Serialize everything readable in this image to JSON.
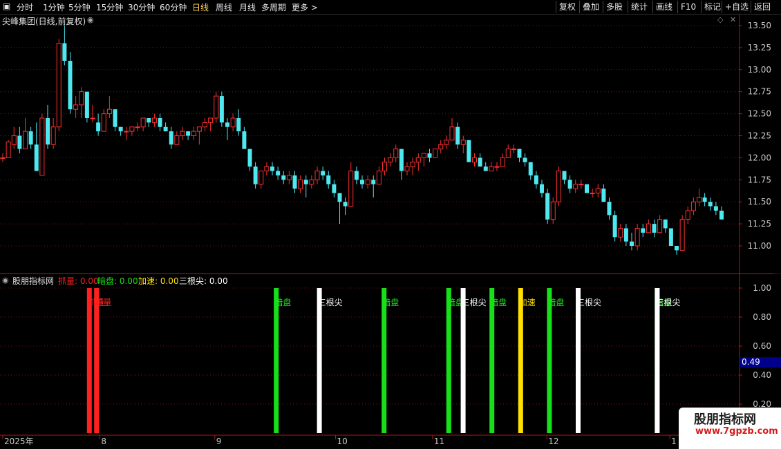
{
  "toolbar": {
    "periods": [
      "分时",
      "1分钟",
      "5分钟",
      "15分钟",
      "30分钟",
      "60分钟",
      "日线",
      "周线",
      "月线",
      "多周期",
      "更多 >"
    ],
    "active_period": "日线",
    "buttons": [
      "复权",
      "叠加",
      "多股",
      "统计",
      "画线",
      "F10",
      "标记",
      "+自选",
      "返回"
    ]
  },
  "main_panel": {
    "title": "尖峰集团(日线,前复权)",
    "price_axis": [
      "13.50",
      "13.25",
      "13.00",
      "12.75",
      "12.50",
      "12.25",
      "12.00",
      "11.75",
      "11.50",
      "11.25",
      "11.00"
    ]
  },
  "indicator_panel": {
    "title": "股朋指标网",
    "fields": [
      {
        "label": "抓量:",
        "value": "0.00",
        "color": "#ff2020"
      },
      {
        "label": "暗盘:",
        "value": "0.00",
        "color": "#18e018"
      },
      {
        "label": "加速:",
        "value": "0.00",
        "color": "#ffe000"
      },
      {
        "label": "三根尖:",
        "value": "0.00",
        "color": "#ffffff"
      }
    ],
    "y_axis": [
      "1.00",
      "0.80",
      "0.60",
      "0.40",
      "0.20"
    ],
    "cursor_value": "0.49"
  },
  "date_axis": [
    "2025年",
    "8",
    "9",
    "10",
    "11",
    "12",
    "1"
  ],
  "watermark": {
    "title": "股朋指标网",
    "url": "www.7gpzb.com"
  },
  "colors": {
    "up": "#ff3030",
    "down": "#4de8f0",
    "grid": "#7a1010",
    "axis": "#b01818"
  },
  "chart_data": {
    "type": "candlestick",
    "yrange_price": [
      10.85,
      13.62
    ],
    "ohlc_estimated": [
      [
        12.0,
        12.05,
        11.95,
        12.0
      ],
      [
        12.0,
        12.2,
        12.0,
        12.18
      ],
      [
        12.15,
        12.35,
        12.1,
        12.25
      ],
      [
        12.25,
        12.35,
        12.05,
        12.1
      ],
      [
        12.1,
        12.45,
        12.1,
        12.3
      ],
      [
        12.3,
        12.35,
        12.1,
        12.15
      ],
      [
        12.15,
        12.4,
        11.85,
        11.85
      ],
      [
        11.8,
        12.5,
        11.8,
        12.45
      ],
      [
        12.45,
        12.6,
        12.1,
        12.15
      ],
      [
        12.15,
        12.45,
        12.1,
        12.35
      ],
      [
        12.35,
        13.35,
        12.3,
        13.3
      ],
      [
        13.3,
        13.5,
        13.05,
        13.1
      ],
      [
        13.1,
        13.2,
        12.5,
        12.55
      ],
      [
        12.55,
        12.7,
        12.45,
        12.6
      ],
      [
        12.6,
        12.8,
        12.45,
        12.75
      ],
      [
        12.75,
        12.75,
        12.4,
        12.45
      ],
      [
        12.45,
        12.6,
        12.4,
        12.45
      ],
      [
        12.4,
        12.5,
        12.25,
        12.3
      ],
      [
        12.3,
        12.55,
        12.3,
        12.5
      ],
      [
        12.5,
        12.7,
        12.45,
        12.55
      ],
      [
        12.55,
        12.55,
        12.3,
        12.35
      ],
      [
        12.35,
        12.35,
        12.25,
        12.3
      ],
      [
        12.3,
        12.35,
        12.2,
        12.3
      ],
      [
        12.3,
        12.35,
        12.25,
        12.35
      ],
      [
        12.35,
        12.4,
        12.3,
        12.35
      ],
      [
        12.35,
        12.45,
        12.3,
        12.45
      ],
      [
        12.45,
        12.45,
        12.35,
        12.4
      ],
      [
        12.4,
        12.5,
        12.35,
        12.45
      ],
      [
        12.45,
        12.5,
        12.3,
        12.35
      ],
      [
        12.35,
        12.4,
        12.3,
        12.3
      ],
      [
        12.3,
        12.35,
        12.1,
        12.15
      ],
      [
        12.15,
        12.3,
        12.15,
        12.25
      ],
      [
        12.25,
        12.35,
        12.2,
        12.3
      ],
      [
        12.3,
        12.3,
        12.2,
        12.25
      ],
      [
        12.25,
        12.35,
        12.2,
        12.3
      ],
      [
        12.3,
        12.35,
        12.15,
        12.35
      ],
      [
        12.35,
        12.45,
        12.3,
        12.4
      ],
      [
        12.4,
        12.45,
        12.3,
        12.45
      ],
      [
        12.45,
        12.75,
        12.4,
        12.7
      ],
      [
        12.7,
        12.75,
        12.35,
        12.4
      ],
      [
        12.4,
        12.45,
        12.2,
        12.35
      ],
      [
        12.35,
        12.5,
        12.3,
        12.45
      ],
      [
        12.45,
        12.55,
        12.25,
        12.3
      ],
      [
        12.3,
        12.35,
        12.1,
        12.1
      ],
      [
        12.1,
        12.1,
        11.85,
        11.9
      ],
      [
        11.9,
        11.95,
        11.65,
        11.7
      ],
      [
        11.7,
        11.85,
        11.65,
        11.85
      ],
      [
        11.85,
        11.95,
        11.8,
        11.9
      ],
      [
        11.9,
        11.95,
        11.8,
        11.85
      ],
      [
        11.85,
        11.9,
        11.75,
        11.8
      ],
      [
        11.8,
        11.85,
        11.7,
        11.75
      ],
      [
        11.75,
        11.85,
        11.7,
        11.8
      ],
      [
        11.8,
        11.85,
        11.6,
        11.65
      ],
      [
        11.65,
        11.8,
        11.6,
        11.75
      ],
      [
        11.75,
        11.8,
        11.55,
        11.7
      ],
      [
        11.7,
        11.8,
        11.65,
        11.75
      ],
      [
        11.75,
        11.9,
        11.7,
        11.85
      ],
      [
        11.85,
        11.9,
        11.75,
        11.8
      ],
      [
        11.8,
        11.85,
        11.65,
        11.7
      ],
      [
        11.7,
        11.75,
        11.55,
        11.6
      ],
      [
        11.6,
        11.6,
        11.25,
        11.5
      ],
      [
        11.5,
        11.55,
        11.35,
        11.45
      ],
      [
        11.45,
        11.95,
        11.45,
        11.85
      ],
      [
        11.85,
        11.9,
        11.7,
        11.75
      ],
      [
        11.75,
        11.8,
        11.65,
        11.7
      ],
      [
        11.7,
        11.8,
        11.65,
        11.75
      ],
      [
        11.75,
        11.8,
        11.55,
        11.7
      ],
      [
        11.7,
        11.9,
        11.7,
        11.85
      ],
      [
        11.85,
        12.0,
        11.8,
        11.95
      ],
      [
        11.95,
        12.05,
        11.9,
        12.0
      ],
      [
        12.0,
        12.15,
        11.95,
        12.1
      ],
      [
        12.1,
        12.1,
        11.75,
        11.85
      ],
      [
        11.85,
        11.95,
        11.8,
        11.9
      ],
      [
        11.9,
        12.0,
        11.8,
        11.95
      ],
      [
        11.95,
        12.05,
        11.85,
        12.0
      ],
      [
        12.0,
        12.05,
        11.9,
        12.05
      ],
      [
        12.05,
        12.1,
        11.95,
        12.0
      ],
      [
        12.0,
        12.1,
        12.0,
        12.1
      ],
      [
        12.1,
        12.2,
        12.05,
        12.15
      ],
      [
        12.15,
        12.25,
        12.1,
        12.2
      ],
      [
        12.2,
        12.45,
        12.2,
        12.35
      ],
      [
        12.35,
        12.4,
        12.1,
        12.15
      ],
      [
        12.15,
        12.25,
        12.05,
        12.2
      ],
      [
        12.2,
        12.2,
        11.95,
        11.95
      ],
      [
        11.95,
        12.05,
        11.9,
        12.0
      ],
      [
        12.0,
        12.05,
        11.9,
        11.9
      ],
      [
        11.9,
        11.95,
        11.85,
        11.85
      ],
      [
        11.85,
        11.95,
        11.85,
        11.9
      ],
      [
        11.9,
        11.95,
        11.85,
        11.9
      ],
      [
        11.9,
        12.05,
        11.9,
        12.0
      ],
      [
        12.0,
        12.15,
        12.0,
        12.1
      ],
      [
        12.1,
        12.15,
        12.05,
        12.1
      ],
      [
        12.1,
        12.1,
        11.95,
        12.0
      ],
      [
        12.0,
        12.05,
        11.9,
        11.95
      ],
      [
        11.95,
        11.95,
        11.75,
        11.8
      ],
      [
        11.8,
        11.85,
        11.65,
        11.7
      ],
      [
        11.7,
        11.75,
        11.55,
        11.6
      ],
      [
        11.6,
        11.65,
        11.25,
        11.3
      ],
      [
        11.3,
        11.55,
        11.25,
        11.5
      ],
      [
        11.5,
        11.9,
        11.45,
        11.85
      ],
      [
        11.85,
        11.85,
        11.7,
        11.75
      ],
      [
        11.75,
        11.8,
        11.6,
        11.65
      ],
      [
        11.65,
        11.75,
        11.6,
        11.7
      ],
      [
        11.7,
        11.75,
        11.65,
        11.7
      ],
      [
        11.7,
        11.7,
        11.6,
        11.6
      ],
      [
        11.6,
        11.65,
        11.55,
        11.6
      ],
      [
        11.6,
        11.7,
        11.55,
        11.65
      ],
      [
        11.65,
        11.7,
        11.5,
        11.5
      ],
      [
        11.5,
        11.55,
        11.3,
        11.35
      ],
      [
        11.35,
        11.4,
        11.05,
        11.1
      ],
      [
        11.1,
        11.25,
        11.05,
        11.2
      ],
      [
        11.2,
        11.25,
        11.0,
        11.05
      ],
      [
        11.05,
        11.15,
        10.95,
        11.0
      ],
      [
        11.0,
        11.25,
        10.95,
        11.2
      ],
      [
        11.2,
        11.25,
        11.1,
        11.15
      ],
      [
        11.15,
        11.3,
        11.15,
        11.25
      ],
      [
        11.25,
        11.3,
        11.1,
        11.15
      ],
      [
        11.15,
        11.35,
        11.15,
        11.3
      ],
      [
        11.3,
        11.3,
        11.15,
        11.2
      ],
      [
        11.2,
        11.2,
        11.0,
        11.0
      ],
      [
        11.0,
        11.0,
        10.9,
        10.95
      ],
      [
        10.95,
        11.35,
        10.95,
        11.3
      ],
      [
        11.3,
        11.45,
        11.25,
        11.4
      ],
      [
        11.4,
        11.55,
        11.35,
        11.5
      ],
      [
        11.5,
        11.65,
        11.45,
        11.55
      ],
      [
        11.55,
        11.6,
        11.45,
        11.5
      ],
      [
        11.5,
        11.55,
        11.4,
        11.45
      ],
      [
        11.45,
        11.5,
        11.35,
        11.4
      ],
      [
        11.4,
        11.45,
        11.3,
        11.3
      ]
    ],
    "signals_series": [
      {
        "name": "抓量",
        "color": "#ff2020",
        "label": "抓量",
        "bars": [
          0.12,
          0.13
        ]
      },
      {
        "name": "暗盘",
        "color": "#18e018",
        "label": "暗盘",
        "bars": [
          0.38,
          0.53,
          0.62,
          0.68,
          0.76,
          0.91
        ]
      },
      {
        "name": "加速",
        "color": "#ffe000",
        "label": "加速",
        "bars": [
          0.72
        ]
      },
      {
        "name": "三根尖",
        "color": "#ffffff",
        "label": "三根尖",
        "bars": [
          0.44,
          0.64,
          0.8,
          0.91
        ]
      }
    ],
    "signal_bar_height": 1.0
  }
}
